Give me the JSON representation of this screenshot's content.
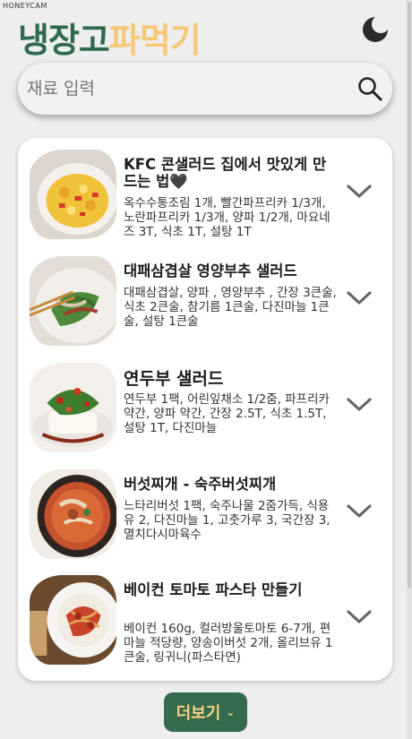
{
  "watermark": "HONEYCAM",
  "header": {
    "logo_part1": "냉장고",
    "logo_part2": "파먹기",
    "theme_icon": "moon-icon"
  },
  "search": {
    "placeholder": "재료 입력",
    "value": "",
    "icon": "search-icon"
  },
  "recipes": [
    {
      "title": "KFC 콘샐러드 집에서 맛있게 만드는 법🖤",
      "ingredients": "옥수수통조림 1개, 빨간파프리카 1/3개, 노란파프리카 1/3개, 양파 1/2개, 마요네즈 3T, 식초 1T, 설탕 1T"
    },
    {
      "title": "대패삼겹살 영양부추 샐러드",
      "ingredients": "대패삼겹살, 양파 , 영양부추 , 간장 3큰술, 식초 2큰술, 참기름 1큰술, 다진마늘 1큰술, 설탕 1큰술"
    },
    {
      "title": "연두부 샐러드",
      "ingredients": "연두부 1팩, 어린잎채소 1/2줌, 파프리카 약간, 양파 약간, 간장 2.5T, 식초 1.5T, 설탕 1T, 다진마늘"
    },
    {
      "title": "버섯찌개 - 숙주버섯찌개",
      "ingredients": "느타리버섯 1팩, 숙주나물 2줌가득, 식용유 2, 다진마늘 1, 고춧가루 3, 국간장 3, 멸치다시마육수"
    },
    {
      "title": "베이컨 토마토 파스타 만들기",
      "ingredients": "베이컨 160g, 컬러방울토마토 6-7개, 편마늘 적당량, 양송이버섯 2개, 올리브유 1큰술, 링귀니(파스타면)"
    }
  ],
  "more_button": {
    "label": "더보기",
    "icon": "chevron-down-icon"
  }
}
